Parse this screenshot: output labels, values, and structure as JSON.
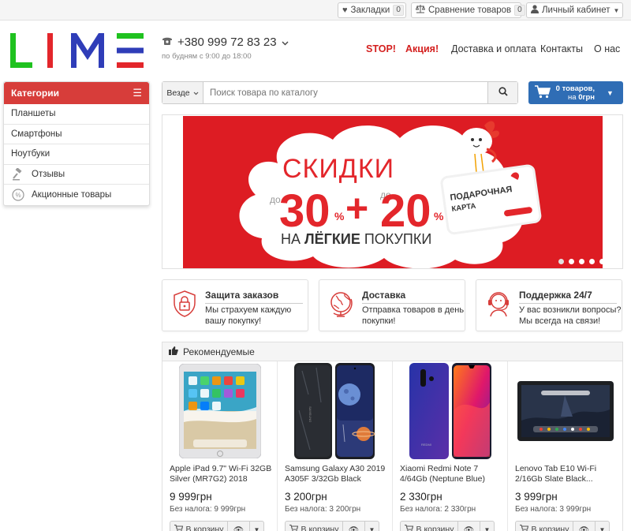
{
  "topbar": {
    "bookmarks": {
      "label": "Закладки",
      "count": "0"
    },
    "compare": {
      "label": "Сравнение товаров",
      "count": "0"
    },
    "account": {
      "label": "Личный кабинет"
    }
  },
  "header": {
    "logo_text": "LIME",
    "phone": "+380 999 72 83 23",
    "hours": "по будням с 9:00 до 18:00",
    "nav": [
      {
        "label": "STOP!",
        "highlight": true
      },
      {
        "label": "Акция!",
        "highlight": true
      },
      {
        "label": "Доставка и оплата",
        "highlight": false
      },
      {
        "label": "Контакты",
        "highlight": false
      },
      {
        "label": "О нас",
        "highlight": false
      }
    ]
  },
  "categories": {
    "title": "Категории",
    "items": [
      {
        "label": "Планшеты",
        "icon": ""
      },
      {
        "label": "Смартфоны",
        "icon": ""
      },
      {
        "label": "Ноутбуки",
        "icon": ""
      },
      {
        "label": "Отзывы",
        "icon": "gavel-icon"
      },
      {
        "label": "Акционные товары",
        "icon": "percent-icon"
      }
    ]
  },
  "search": {
    "scope": "Везде",
    "placeholder": "Поиск товара по каталогу"
  },
  "cart": {
    "line1": "0 товаров,",
    "line2_prefix": "на ",
    "total": "0грн"
  },
  "banner": {
    "headline": "СКИДКИ",
    "do1": "до",
    "val1": "30",
    "pct": "%",
    "plus": "+",
    "do2": "до",
    "val2": "20",
    "sub_light1": "НА ",
    "sub_bold": "ЛЁГКИЕ",
    "sub_light2": " ПОКУПКИ",
    "card_line1": "ПОДАРОЧНАЯ",
    "card_line2": "КАРТА",
    "slides": 5,
    "active_slide": 0
  },
  "features": [
    {
      "title": "Защита заказов",
      "desc": "Мы страхуем каждую вашу покупку!",
      "icon": "lock-shield-icon"
    },
    {
      "title": "Доставка",
      "desc": "Отправка товаров в день покупки!",
      "icon": "globe-icon"
    },
    {
      "title": "Поддержка 24/7",
      "desc": "У вас возникли вопросы? Мы всегда на связи!",
      "icon": "support-agent-icon"
    }
  ],
  "recommended": {
    "title": "Рекомендуемые",
    "buy_label": "В корзину",
    "products": [
      {
        "name": "Apple iPad 9.7\" Wi-Fi 32GB Silver (MR7G2) 2018",
        "price": "9 999грн",
        "tax": "Без налога: 9 999грн"
      },
      {
        "name": "Samsung Galaxy A30 2019 A305F 3/32Gb Black",
        "price": "3 200грн",
        "tax": "Без налога: 3 200грн"
      },
      {
        "name": "Xiaomi Redmi Note 7 4/64Gb (Neptune Blue)",
        "price": "2 330грн",
        "tax": "Без налога: 2 330грн"
      },
      {
        "name": "Lenovo Tab E10 Wi-Fi 2/16Gb Slate Black...",
        "price": "3 999грн",
        "tax": "Без налога: 3 999грн"
      }
    ]
  },
  "colors": {
    "accent_red": "#d73d3a",
    "cart_blue": "#2f6db5",
    "banner_red": "#dd1c23"
  }
}
